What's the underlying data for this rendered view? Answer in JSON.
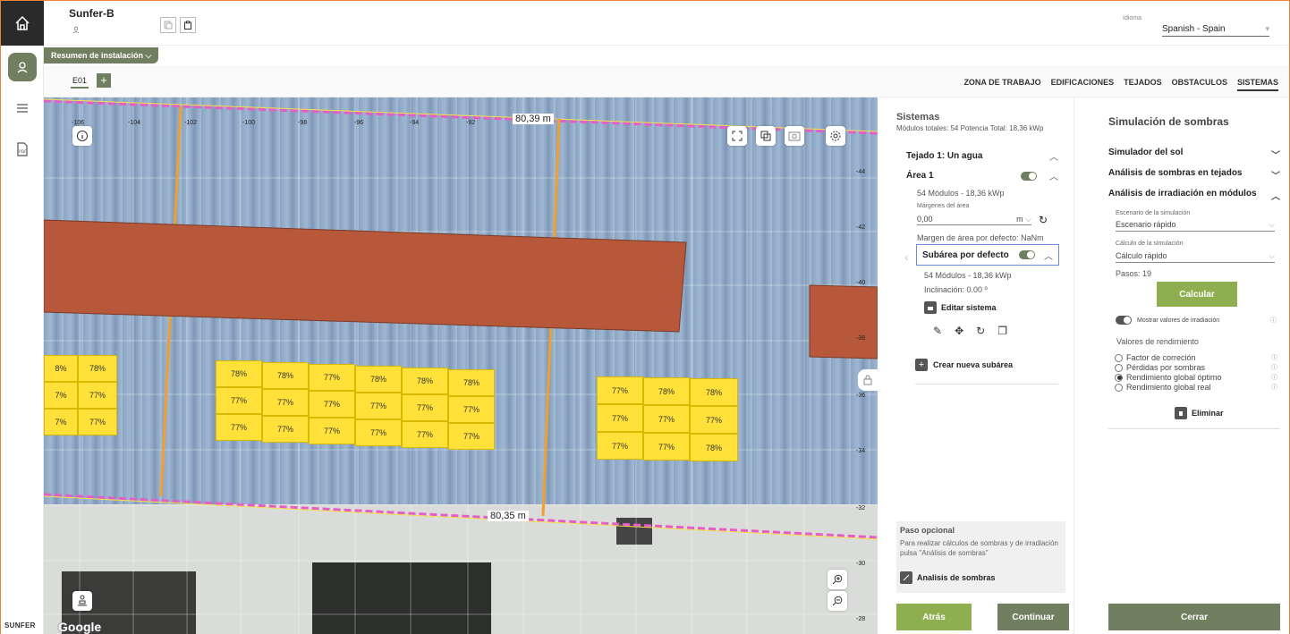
{
  "header": {
    "project_name": "Sunfer-B",
    "lang_label": "Idioma",
    "lang_value": "Spanish - Spain"
  },
  "rail": {
    "brand": "SUNFER"
  },
  "summary_button": "Resumen de instalación",
  "subbar": {
    "building_tab": "E01",
    "add_label": "+",
    "tabs": [
      "ZONA DE TRABAJO",
      "EDIFICACIONES",
      "TEJADOS",
      "OBSTACULOS",
      "SISTEMAS"
    ],
    "active_tab": "SISTEMAS"
  },
  "map": {
    "measure_top": "80,39 m",
    "measure_bottom": "80,35 m",
    "google": "Google",
    "x_ticks": [
      "-106",
      "-104",
      "-102",
      "-100",
      "-98",
      "-96",
      "-94",
      "-92"
    ],
    "y_ticks": [
      "-44",
      "-42",
      "-40",
      "-38",
      "-36",
      "-34",
      "-32",
      "-30",
      "-28"
    ],
    "group_left": [
      [
        "8%",
        "78%"
      ],
      [
        "7%",
        "77%"
      ],
      [
        "7%",
        "77%"
      ]
    ],
    "group_mid": [
      [
        "78%",
        "78%",
        "77%",
        "78%",
        "78%",
        "78%"
      ],
      [
        "77%",
        "77%",
        "77%",
        "77%",
        "77%",
        "77%"
      ],
      [
        "77%",
        "77%",
        "77%",
        "77%",
        "77%",
        "77%"
      ]
    ],
    "group_right": [
      [
        "77%",
        "78%",
        "78%"
      ],
      [
        "77%",
        "77%",
        "77%"
      ],
      [
        "77%",
        "77%",
        "78%"
      ]
    ]
  },
  "systems": {
    "title": "Sistemas",
    "summary": "Módulos totales: 54 Potencia Total: 18,36 kWp",
    "roof": "Tejado 1: Un agua",
    "area": "Área 1",
    "area_modules": "54 Módulos - 18,36 kWp",
    "margins_label": "Márgenes del área",
    "margins_value": "0,00",
    "margins_unit": "m",
    "default_margin": "Margen de área por defecto: NaNm",
    "subarea": "Subárea por defecto 1",
    "subarea_modules": "54 Módulos - 18,36 kWp",
    "inclination": "Inclinación: 0.00 º",
    "edit_system": "Editar sistema",
    "new_subarea": "Crear nueva subárea",
    "optional_title": "Paso opcional",
    "optional_text": "Para realizar cálculos de sombras y de irradiación pulsa \"Análisis de sombras\"",
    "shadow_analysis": "Analisis de sombras",
    "back": "Atrás",
    "continue": "Continuar"
  },
  "shadow_panel": {
    "title": "Simulación de sombras",
    "sun_sim": "Simulador del sol",
    "roof_shadow": "Análisis de sombras en tejados",
    "module_irr": "Análisis de irradiación en módulos",
    "scenario_label": "Escenario de la simulación",
    "scenario_value": "Escenario rápido",
    "calc_label": "Cálculo de la simulación",
    "calc_value": "Cálculo rápido",
    "steps": "Pasos: 19",
    "calculate": "Calcular",
    "show_values": "Mostrar valores de irradiación",
    "perf_label": "Valores de rendimiento",
    "options": [
      "Factor de correción",
      "Pérdidas por sombras",
      "Rendimiento global óptimo",
      "Rendimiento global real"
    ],
    "selected_option": "Rendimiento global óptimo",
    "delete": "Eliminar",
    "close": "Cerrar"
  }
}
